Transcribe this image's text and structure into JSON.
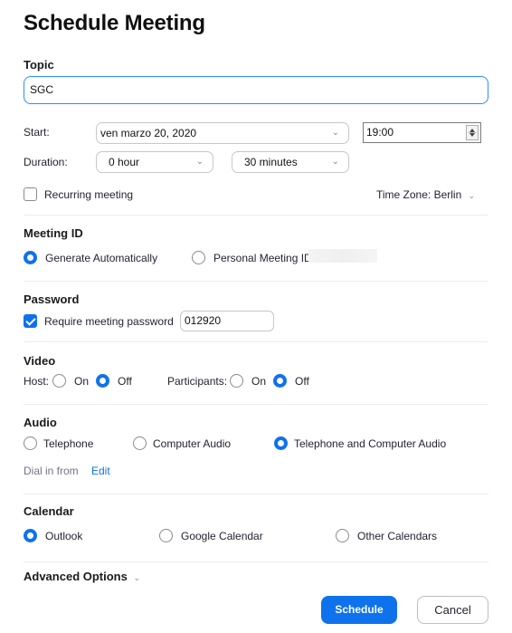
{
  "dialog": {
    "title": "Schedule Meeting"
  },
  "topic": {
    "label": "Topic",
    "value": "SGC"
  },
  "start": {
    "label": "Start:",
    "date": "ven  marzo 20, 2020",
    "time": "19:00"
  },
  "duration": {
    "label": "Duration:",
    "hours": "0 hour",
    "minutes": "30 minutes"
  },
  "recurring": {
    "label": "Recurring meeting",
    "checked": false
  },
  "timezone": {
    "label": "Time Zone: Berlin"
  },
  "meeting_id": {
    "title": "Meeting ID",
    "options": [
      {
        "label": "Generate Automatically",
        "selected": true
      },
      {
        "label": "Personal Meeting ID",
        "selected": false
      }
    ]
  },
  "password": {
    "title": "Password",
    "require_label": "Require meeting password",
    "checked": true,
    "value": "012920"
  },
  "video": {
    "title": "Video",
    "host_label": "Host:",
    "participants_label": "Participants:",
    "on_label": "On",
    "off_label": "Off",
    "host": "Off",
    "participants": "Off"
  },
  "audio": {
    "title": "Audio",
    "options": [
      {
        "label": "Telephone",
        "selected": false
      },
      {
        "label": "Computer Audio",
        "selected": false
      },
      {
        "label": "Telephone and Computer Audio",
        "selected": true
      }
    ],
    "dial_in_label": "Dial in from",
    "edit_label": "Edit"
  },
  "calendar": {
    "title": "Calendar",
    "options": [
      {
        "label": "Outlook",
        "selected": true
      },
      {
        "label": "Google Calendar",
        "selected": false
      },
      {
        "label": "Other Calendars",
        "selected": false
      }
    ]
  },
  "advanced": {
    "label": "Advanced Options"
  },
  "buttons": {
    "schedule": "Schedule",
    "cancel": "Cancel"
  },
  "colors": {
    "accent": "#0e72ed",
    "focus_border": "#2d8cff"
  }
}
